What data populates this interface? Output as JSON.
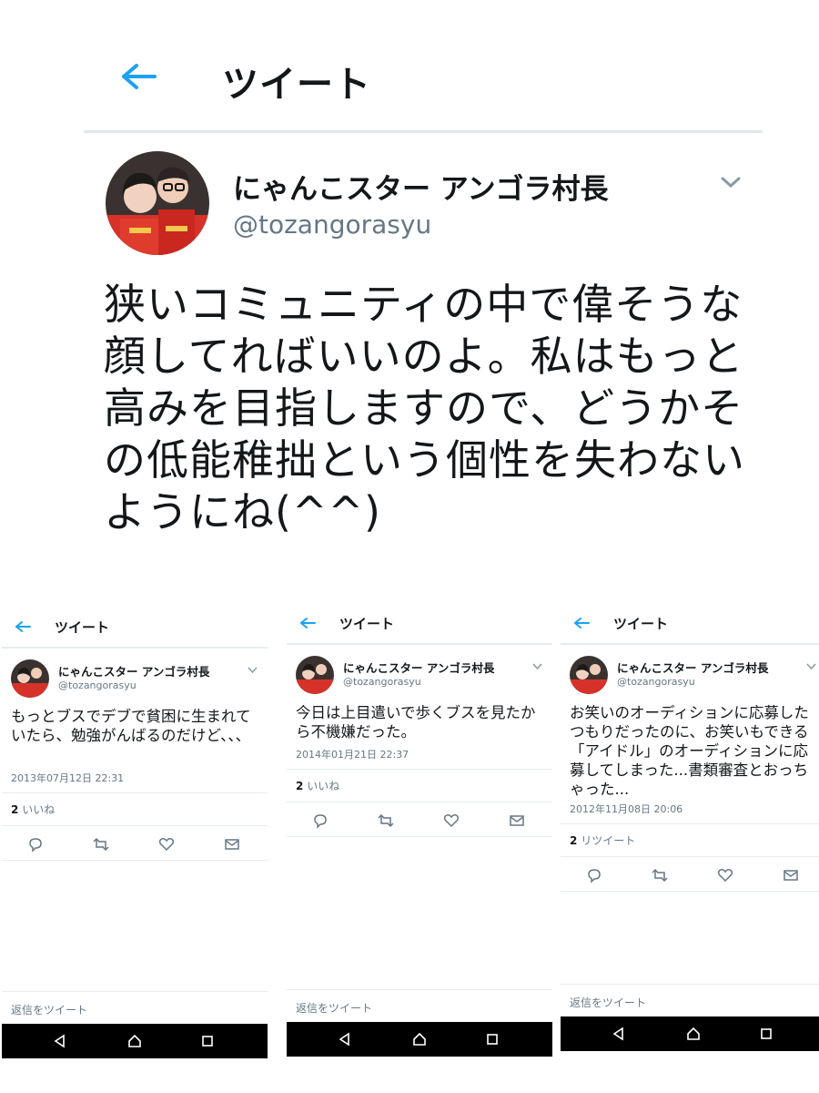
{
  "main": {
    "title": "ツイート",
    "user_name": "にゃんこスター アンゴラ村長",
    "handle": "@tozangorasyu",
    "text": "狭いコミュニティの中で偉そうな顔してればいいのよ。私はもっと高みを目指しますので、どうかその低能稚拙という個性を失わないようにね(^^)"
  },
  "panels": [
    {
      "title": "ツイート",
      "user_name": "にゃんこスター アンゴラ村長",
      "handle": "@tozangorasyu",
      "text": "もっとブスでデブで貧困に生まれていたら、勉強がんばるのだけど、、、",
      "timestamp": "2013年07月12日 22:31",
      "count": "2",
      "count_label": "いいね",
      "reply_placeholder": "返信をツイート"
    },
    {
      "title": "ツイート",
      "user_name": "にゃんこスター アンゴラ村長",
      "handle": "@tozangorasyu",
      "text": "今日は上目遣いで歩くブスを見たから不機嫌だった。",
      "timestamp": "2014年01月21日 22:37",
      "count": "2",
      "count_label": "いいね",
      "reply_placeholder": "返信をツイート"
    },
    {
      "title": "ツイート",
      "user_name": "にゃんこスター アンゴラ村長",
      "handle": "@tozangorasyu",
      "text": "お笑いのオーディションに応募したつもりだったのに、お笑いもできる「アイドル」のオーディションに応募してしまった...書類審査とおっちゃった...",
      "timestamp": "2012年11月08日 20:06",
      "count": "2",
      "count_label": "リツイート",
      "reply_placeholder": "返信をツイート"
    }
  ],
  "icons": {
    "back": "back-arrow-icon",
    "caret": "chevron-down-icon",
    "reply": "reply-icon",
    "retweet": "retweet-icon",
    "like": "heart-icon",
    "dm": "envelope-icon",
    "nav_back": "triangle-back-icon",
    "nav_home": "home-icon",
    "nav_recent": "square-recent-icon"
  },
  "colors": {
    "accent": "#1da1f2",
    "text": "#14171a",
    "secondary": "#657786",
    "divider": "#e6ecf0",
    "avatar_shirt": "#d6322a"
  }
}
